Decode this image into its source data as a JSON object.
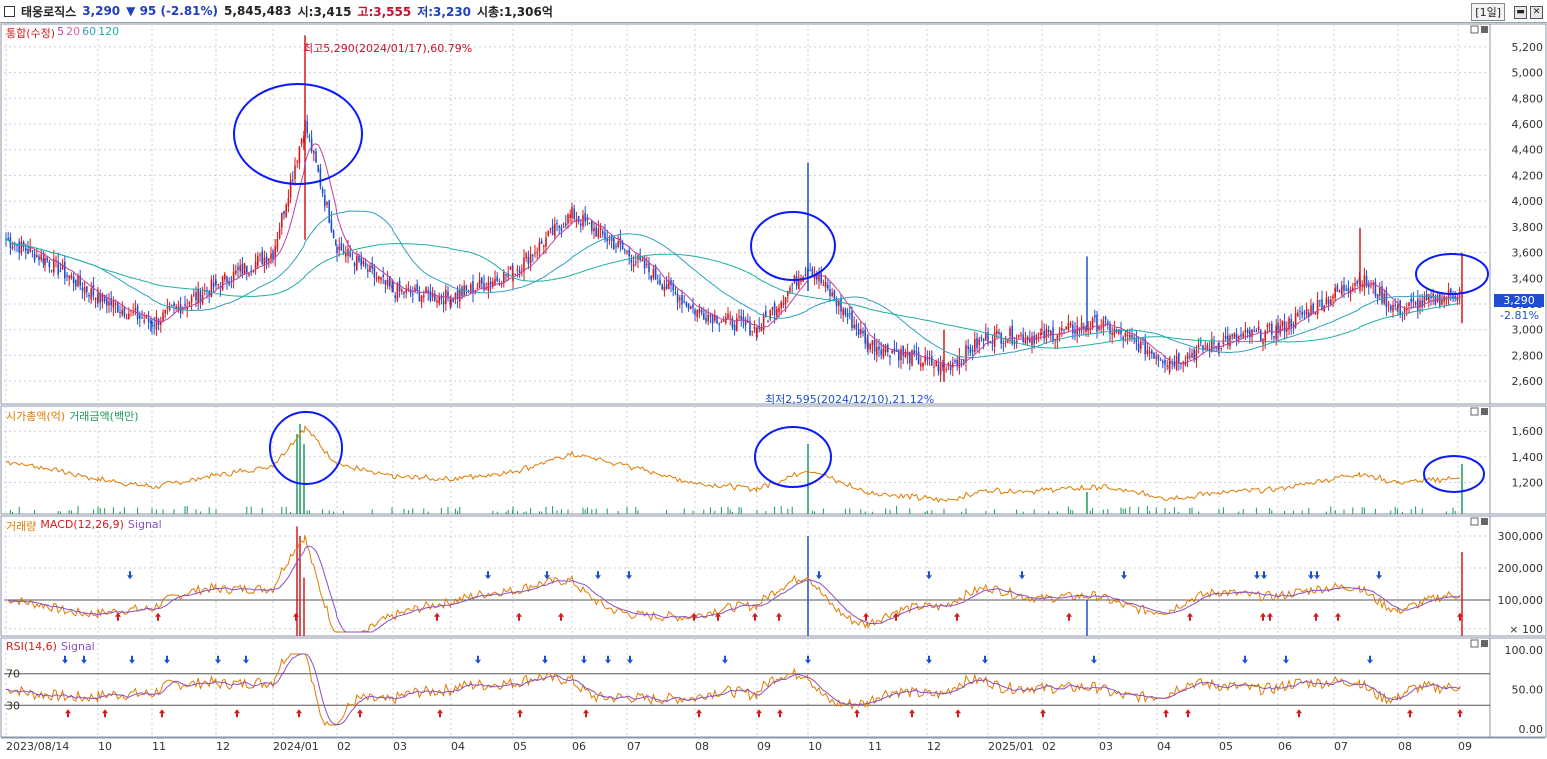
{
  "header": {
    "stock_name": "태웅로직스",
    "price": "3,290",
    "change": "▼ 95 (-2.81%)",
    "volume": "5,845,483",
    "open": "시:3,415",
    "high": "고:3,555",
    "low": "저:3,230",
    "market_cap": "시총:1,306억",
    "period_label": "[1일]"
  },
  "colors": {
    "up": "#d7191c",
    "down": "#1f4fd1",
    "ma5": "#c040a0",
    "ma20": "#e060a0",
    "ma60": "#30a0c0",
    "ma120": "#20b0a0",
    "orange": "#e07b00",
    "green": "#1a9a5a",
    "annotation": "#0a1aff"
  },
  "panels": {
    "price_legend": [
      "통합(수정)",
      "5",
      "20",
      "60",
      "120"
    ],
    "value_legend": [
      "시가총액(억)",
      "거래금액(백만)"
    ],
    "volume_legend": [
      "거래량",
      "MACD(12,26,9)",
      "Signal"
    ],
    "rsi_legend": [
      "RSI(14,6)",
      "Signal"
    ]
  },
  "annotations": {
    "high_note": "최고5,290(2024/01/17),60.79%",
    "low_note": "최저2,595(2024/12/10),21.12%",
    "current_price_tag": "3,290",
    "current_change_tag": "-2.81%"
  },
  "chart_data": [
    {
      "type": "line",
      "title": "",
      "series_names": [
        "통합(수정)",
        "5",
        "20",
        "60",
        "120"
      ],
      "y_ticks": [
        "5,200",
        "5,000",
        "4,800",
        "4,600",
        "4,400",
        "4,200",
        "4,000",
        "3,800",
        "3,600",
        "3,400",
        "3,200",
        "3,000",
        "2,800",
        "2,600"
      ],
      "ylim": [
        2500,
        5300
      ],
      "x_ticks": [
        "2023/08/14",
        "10",
        "11",
        "12",
        "2024/01",
        "02",
        "03",
        "04",
        "05",
        "06",
        "07",
        "08",
        "09",
        "10",
        "11",
        "12",
        "2025/01",
        "02",
        "03",
        "04",
        "05",
        "06",
        "07",
        "08",
        "09"
      ],
      "close_path_points": [
        [
          "2023/08/14",
          3700
        ],
        [
          "2023-09",
          3550
        ],
        [
          "2023-10",
          3250
        ],
        [
          "2023-11",
          3050
        ],
        [
          "2023-12",
          3350
        ],
        [
          "2024/01",
          3600
        ],
        [
          "2024/01/17",
          4600
        ],
        [
          "2024-02",
          3650
        ],
        [
          "2024-03",
          3300
        ],
        [
          "2024-04",
          3250
        ],
        [
          "2024-05",
          3450
        ],
        [
          "2024-06",
          3900
        ],
        [
          "2024-07",
          3600
        ],
        [
          "2024-08",
          3150
        ],
        [
          "2024-09",
          3000
        ],
        [
          "2024-10",
          3500
        ],
        [
          "2024-11",
          2900
        ],
        [
          "2024/12/10",
          2700
        ],
        [
          "2025/01",
          2950
        ],
        [
          "2025-02",
          2950
        ],
        [
          "2025-03",
          3050
        ],
        [
          "2025-04",
          2750
        ],
        [
          "2025-05",
          2900
        ],
        [
          "2025-06",
          3000
        ],
        [
          "2025-07",
          3400
        ],
        [
          "2025-08",
          3150
        ],
        [
          "2025-09",
          3290
        ]
      ],
      "high": 5290,
      "low": 2595
    },
    {
      "type": "line",
      "series_names": [
        "시가총액(억)",
        "거래금액(백만)"
      ],
      "y_ticks": [
        "1,600",
        "1,400",
        "1,200"
      ],
      "ylim": [
        1000,
        1750
      ]
    },
    {
      "type": "line",
      "series_names": [
        "거래량",
        "MACD(12,26,9)",
        "Signal"
      ],
      "y_ticks": [
        "300,000",
        "200,000",
        "100,000",
        "× 100"
      ],
      "ylim": [
        0,
        350000
      ]
    },
    {
      "type": "line",
      "series_names": [
        "RSI(14,6)",
        "Signal"
      ],
      "y_ticks": [
        "100.00",
        "50.00",
        "0.00"
      ],
      "levels": [
        "70",
        "30"
      ],
      "ylim": [
        0,
        100
      ]
    }
  ]
}
